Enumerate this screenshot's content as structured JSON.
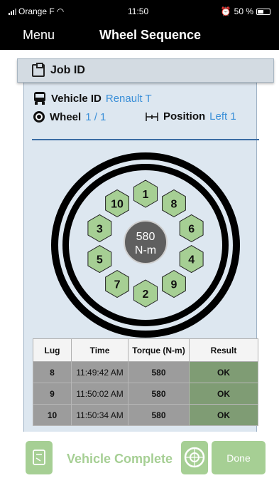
{
  "status_bar": {
    "carrier": "Orange F",
    "time": "11:50",
    "battery": "50 %"
  },
  "nav": {
    "menu_label": "Menu",
    "title": "Wheel Sequence"
  },
  "job": {
    "label": "Job ID"
  },
  "vehicle": {
    "label": "Vehicle ID",
    "value": "Renault T"
  },
  "wheel": {
    "label": "Wheel",
    "value": "1 / 1"
  },
  "position": {
    "label": "Position",
    "value": "Left 1"
  },
  "torque_center": {
    "value": "580",
    "unit": "N-m"
  },
  "lugs": [
    "1",
    "8",
    "6",
    "4",
    "9",
    "2",
    "7",
    "5",
    "3",
    "10"
  ],
  "table": {
    "headers": [
      "Lug",
      "Time",
      "Torque (N-m)",
      "Result"
    ],
    "rows": [
      {
        "lug": "8",
        "time": "11:49:42 AM",
        "torque": "580",
        "result": "OK"
      },
      {
        "lug": "9",
        "time": "11:50:02 AM",
        "torque": "580",
        "result": "OK"
      },
      {
        "lug": "10",
        "time": "11:50:34 AM",
        "torque": "580",
        "result": "OK"
      }
    ]
  },
  "footer": {
    "complete_label": "Vehicle Complete",
    "done_label": "Done"
  },
  "colors": {
    "accent_blue": "#3a8fd8",
    "lug_green": "#a6cf94",
    "ok_green": "#7f9c74",
    "panel_bg": "#dde7f0"
  }
}
